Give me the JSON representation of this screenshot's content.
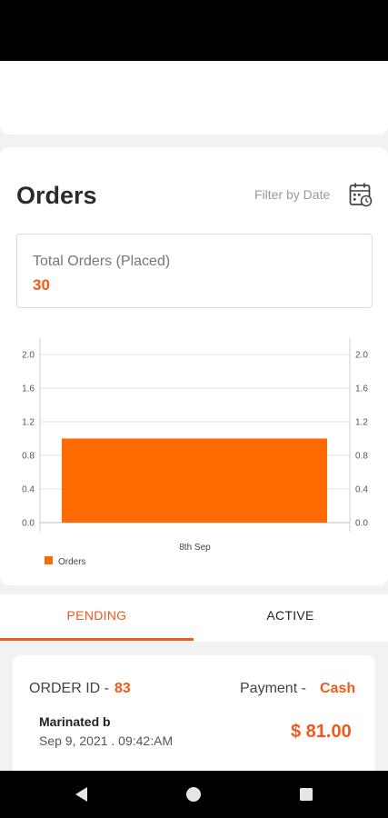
{
  "orders_section": {
    "title": "Orders",
    "filter_label": "Filter by Date",
    "filter_icon": "calendar-clock-icon"
  },
  "summary": {
    "label": "Total Orders (Placed)",
    "value": "30"
  },
  "chart_data": {
    "type": "bar",
    "categories": [
      "8th Sep"
    ],
    "series": [
      {
        "name": "Orders",
        "values": [
          1.0
        ]
      }
    ],
    "ylim": [
      0.0,
      2.0
    ],
    "y_ticks": [
      "0.0",
      "0.4",
      "0.8",
      "1.2",
      "1.6",
      "2.0"
    ],
    "right_axis_ticks": [
      "0.0",
      "0.4",
      "0.8",
      "1.2",
      "1.6",
      "2.0"
    ],
    "grid": true,
    "legend": "bottom-left",
    "bar_color": "#ff6a00"
  },
  "tabs": [
    {
      "label": "PENDING",
      "selected": true
    },
    {
      "label": "ACTIVE",
      "selected": false
    }
  ],
  "order": {
    "id_label": "ORDER ID - ",
    "id": "83",
    "payment_label": "Payment - ",
    "payment": "Cash",
    "item": "Marinated b",
    "date": "Sep 9, 2021 . 09:42:AM",
    "total": "$ 81.00"
  },
  "navigation": {
    "back_icon": "back-triangle-icon",
    "home_icon": "home-circle-icon",
    "recents_icon": "recents-square-icon"
  },
  "colors": {
    "accent": "#f05a1a",
    "bar": "#ff6a00"
  }
}
